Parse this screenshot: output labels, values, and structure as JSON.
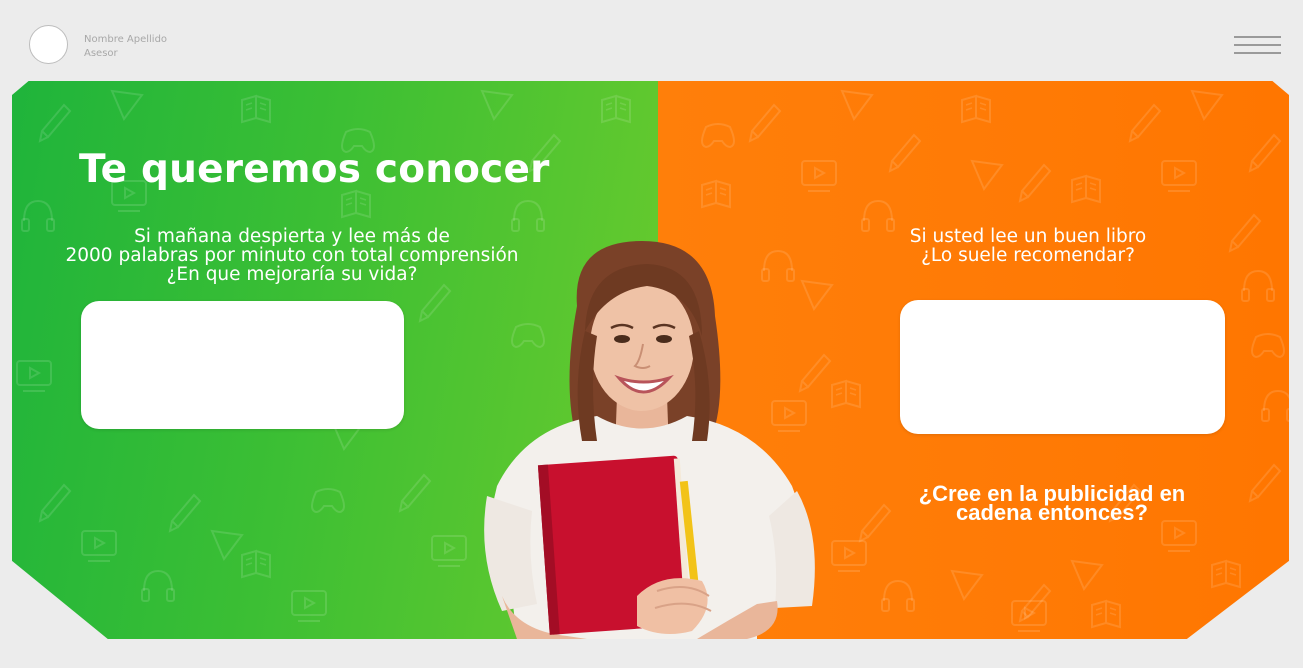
{
  "header": {
    "user_name": "Nombre Apellido",
    "user_role": "Asesor",
    "avatar_icon": "avatar-circle-icon",
    "menu_icon": "hamburger-menu-icon"
  },
  "banner": {
    "title": "Te queremos conocer",
    "left_question": "Si mañana despierta y lee más de\n2000 palabras por minuto con total comprensión\n¿En que mejoraría su vida?",
    "right_question": "Si usted lee un buen libro\n¿Lo suele recomendar?",
    "right_question_2": "¿Cree en la publicidad en\ncadena entonces?",
    "left_answer_value": "",
    "right_answer_value": ""
  },
  "colors": {
    "page_background": "#ececec",
    "green_panel": "#3cbf34",
    "orange_panel": "#ff7a05",
    "text_on_panel": "#ffffff"
  },
  "image": {
    "subject": "smiling young woman holding a red book and a pencil"
  }
}
